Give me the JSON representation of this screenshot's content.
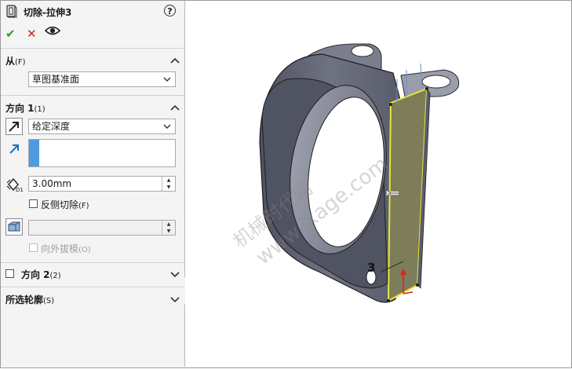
{
  "panel": {
    "title": "切除-拉伸3",
    "help_symbol": "?",
    "actions": {
      "ok": "✔",
      "cancel": "✕"
    }
  },
  "from_section": {
    "title": "从",
    "shortcut": "(F)",
    "selected": "草图基准面"
  },
  "direction1": {
    "title": "方向 1",
    "shortcut": "(1)",
    "end_condition": "给定深度",
    "depth_value": "3.00mm",
    "flip_side_label": "反侧切除",
    "flip_side_shortcut": "(F)",
    "flip_side_checked": false,
    "draft_value": "",
    "draft_outward_label": "向外拔模",
    "draft_outward_shortcut": "(O)",
    "draft_outward_enabled": false
  },
  "direction2": {
    "title": "方向 2",
    "shortcut": "(2)",
    "checked": false
  },
  "selected_contours": {
    "title": "所选轮廓",
    "shortcut": "(S)"
  },
  "viewport": {
    "dimension_label": "3",
    "watermark_line1": "机械时代网",
    "watermark_line2": "www.jxage.com"
  },
  "colors": {
    "part_body": "#5f6373",
    "selected_face": "#7e7d5a",
    "selection_edge": "#e8e43a",
    "list_selection": "#4e9be0",
    "ok_green": "#2e9b2e",
    "cancel_red": "#d02020"
  }
}
